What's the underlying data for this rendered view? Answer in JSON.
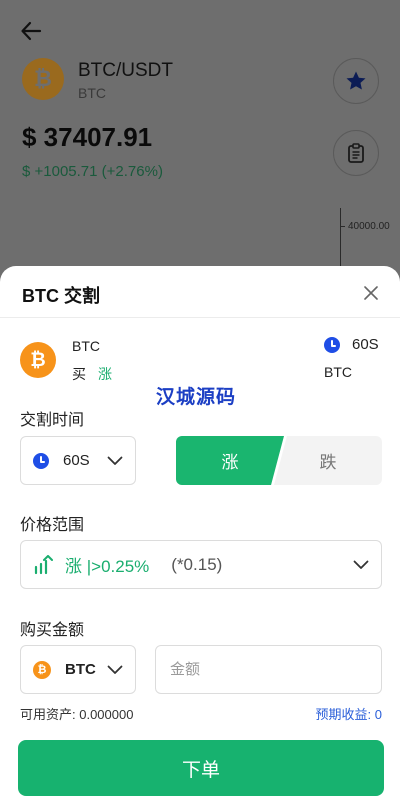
{
  "background": {
    "pair": "BTC/USDT",
    "base": "BTC",
    "price": "$ 37407.91",
    "change": "$ +1005.71 (+2.76%)",
    "axis_label": "40000.00",
    "coin_glyph": "₿"
  },
  "sheet": {
    "title": "BTC 交割",
    "summary": {
      "base": "BTC",
      "direction_label": "买",
      "direction": "涨",
      "time": "60S",
      "unit": "BTC"
    },
    "watermark": "汉城源码",
    "delivery_time": {
      "label": "交割时间",
      "value": "60S"
    },
    "direction_toggle": {
      "up": "涨",
      "down": "跌"
    },
    "price_range": {
      "label": "价格范围",
      "value": "涨 |>0.25%",
      "multiplier": "(*0.15)"
    },
    "purchase": {
      "label": "购买金额",
      "coin": "BTC",
      "amount_placeholder": "金额",
      "available": "可用资产: 0.000000",
      "expected_profit": "预期收益: 0"
    },
    "submit": "下单"
  },
  "colors": {
    "accent_green": "#17b26f",
    "link_blue": "#2b5fd9",
    "btc_orange": "#f7931a",
    "clock_blue": "#1f4ee6"
  }
}
